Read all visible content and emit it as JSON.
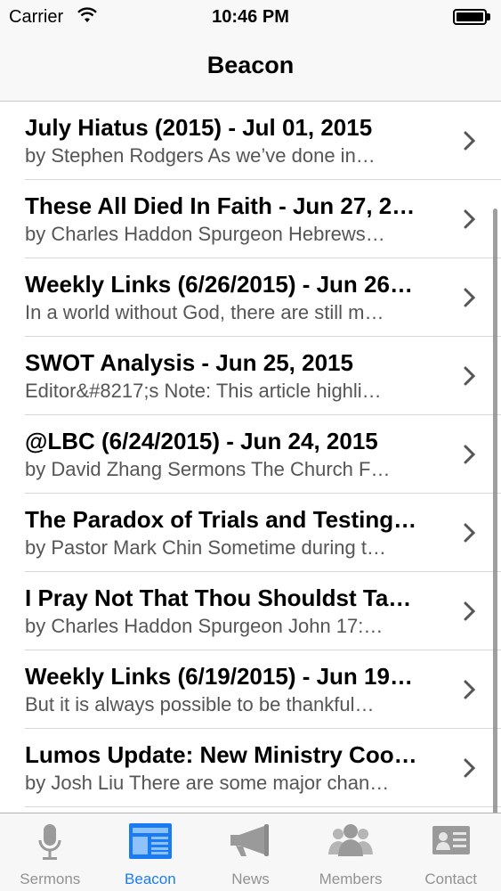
{
  "status_bar": {
    "carrier": "Carrier",
    "time": "10:46 PM"
  },
  "nav": {
    "title": "Beacon"
  },
  "list": {
    "items": [
      {
        "title": "July Hiatus (2015) - Jul 01, 2015",
        "subtitle": "by Stephen Rodgers As we’ve done in…"
      },
      {
        "title": "These All Died In Faith - Jun 27, 2…",
        "subtitle": "by Charles Haddon Spurgeon Hebrews…"
      },
      {
        "title": "Weekly Links (6/26/2015) - Jun 26…",
        "subtitle": "In a world without God, there are still m…"
      },
      {
        "title": "SWOT Analysis - Jun 25, 2015",
        "subtitle": "Editor&#8217;s Note: This article highli…"
      },
      {
        "title": "@LBC (6/24/2015) - Jun 24, 2015",
        "subtitle": "by David Zhang Sermons The Church F…"
      },
      {
        "title": "The Paradox of Trials and Testing…",
        "subtitle": "by Pastor Mark Chin Sometime during t…"
      },
      {
        "title": "I Pray Not That Thou Shouldst Ta…",
        "subtitle": "by Charles Haddon Spurgeon John 17:…"
      },
      {
        "title": "Weekly Links (6/19/2015) - Jun 19…",
        "subtitle": "But it is always possible to be thankful…"
      },
      {
        "title": "Lumos Update: New Ministry Coo…",
        "subtitle": "by Josh Liu There are some major chan…"
      }
    ]
  },
  "tabs": [
    {
      "label": "Sermons",
      "icon": "microphone-icon",
      "active": false
    },
    {
      "label": "Beacon",
      "icon": "newspaper-icon",
      "active": true
    },
    {
      "label": "News",
      "icon": "megaphone-icon",
      "active": false
    },
    {
      "label": "Members",
      "icon": "people-icon",
      "active": false
    },
    {
      "label": "Contact",
      "icon": "contact-card-icon",
      "active": false
    }
  ],
  "colors": {
    "accent": "#1a7cf5",
    "inactive_tab": "#929292"
  }
}
